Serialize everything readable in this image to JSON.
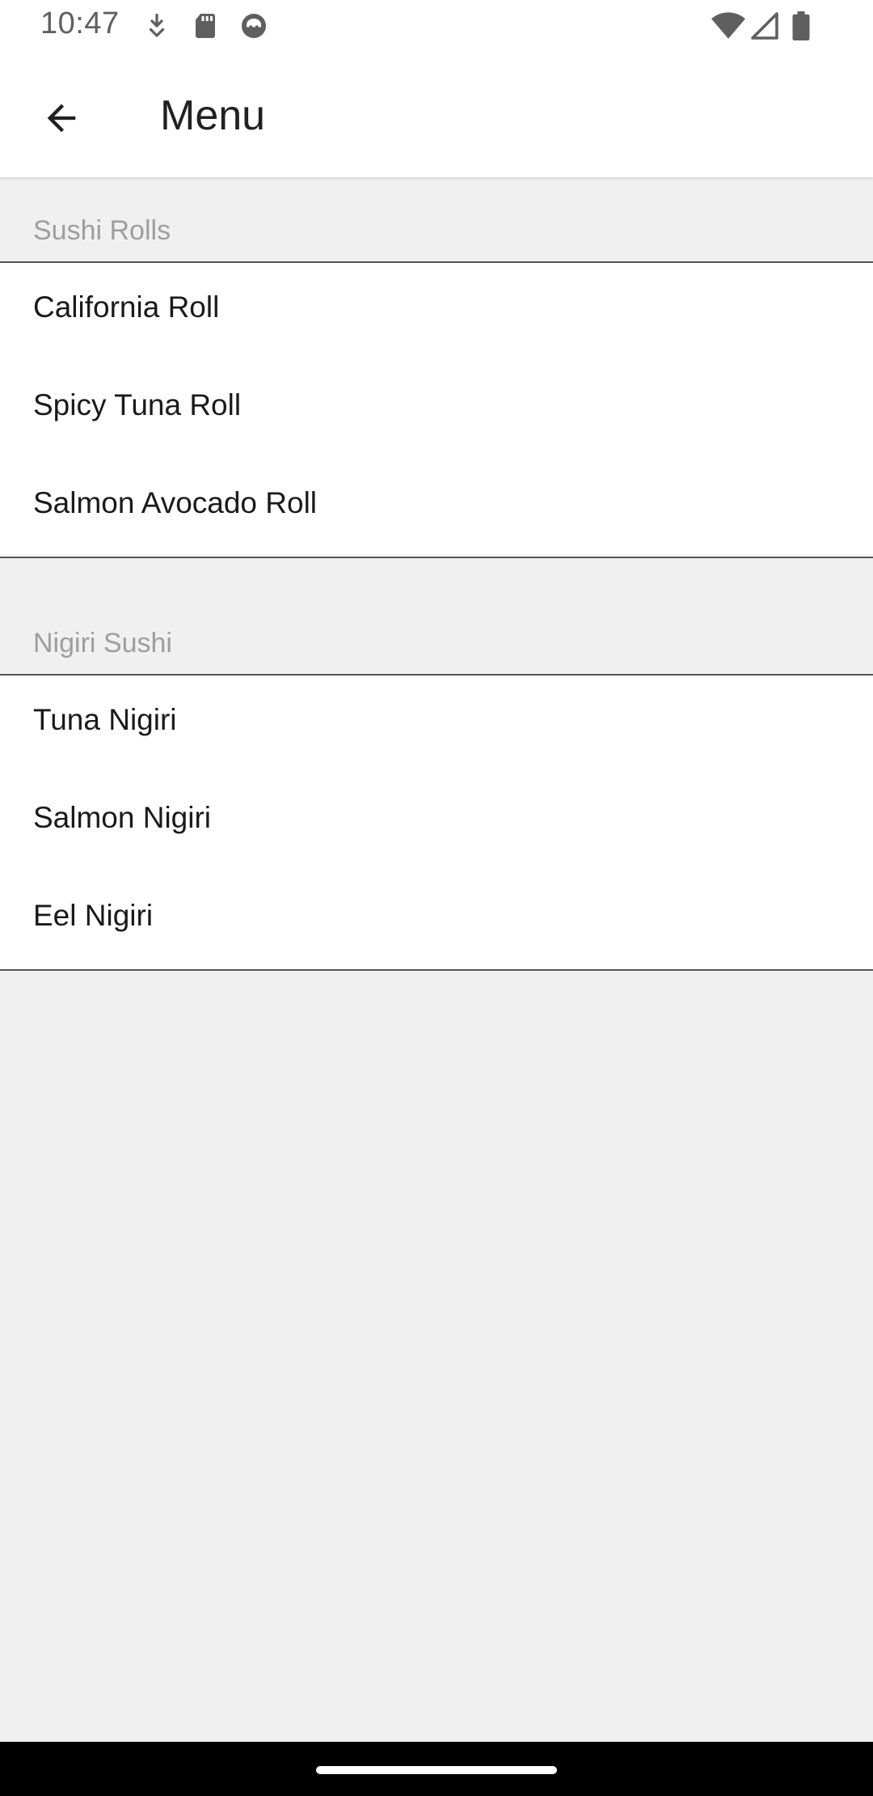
{
  "status_bar": {
    "time": "10:47",
    "left_icons": [
      "download-icon",
      "sd-card-icon",
      "cat-face-icon"
    ],
    "right_icons": [
      "wifi-icon",
      "cellular-signal-icon",
      "battery-icon"
    ]
  },
  "app_bar": {
    "back_icon": "arrow-left-icon",
    "title": "Menu"
  },
  "sections": [
    {
      "header": "Sushi Rolls",
      "items": [
        "California Roll",
        "Spicy Tuna Roll",
        "Salmon Avocado Roll"
      ]
    },
    {
      "header": "Nigiri Sushi",
      "items": [
        "Tuna Nigiri",
        "Salmon Nigiri",
        "Eel Nigiri"
      ]
    }
  ],
  "colors": {
    "background": "#f0f0f0",
    "surface": "#ffffff",
    "section_header_text": "#9e9e9e",
    "divider": "#555555"
  }
}
